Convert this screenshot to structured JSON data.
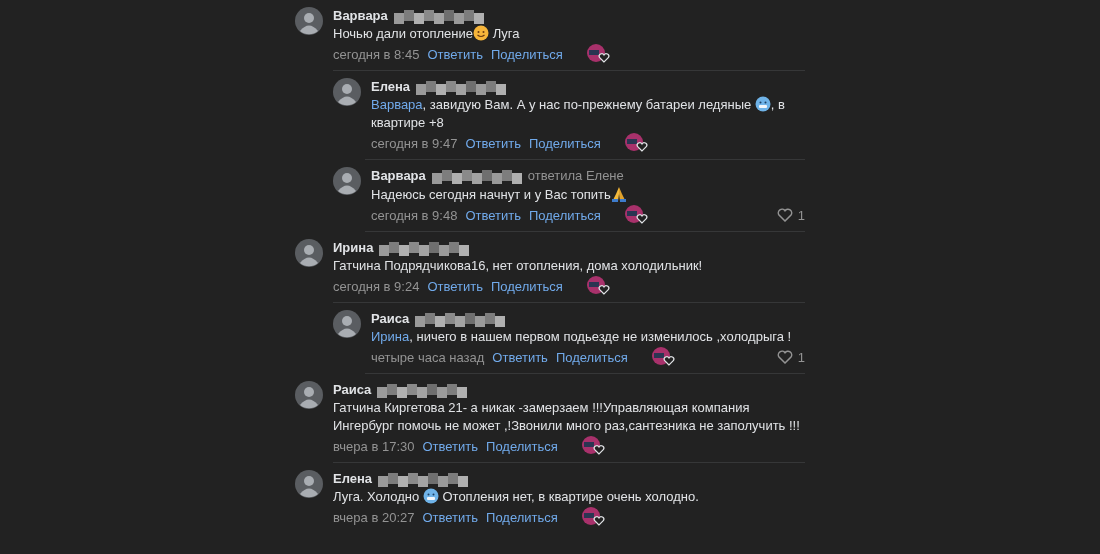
{
  "comments": [
    {
      "author": "Варвара",
      "text": [
        {
          "kind": "text",
          "text": "Ночью дали отопление"
        },
        {
          "kind": "smile"
        },
        {
          "kind": "text",
          "text": " Луга"
        }
      ],
      "time": "сегодня в 8:45",
      "reply": "Ответить",
      "share": "Поделиться",
      "replies": [
        {
          "author": "Елена",
          "text": [
            {
              "kind": "mention",
              "text": "Варвара"
            },
            {
              "kind": "text",
              "text": ", завидую Вам. А у нас по-прежнему батареи ледяные "
            },
            {
              "kind": "cold"
            },
            {
              "kind": "text",
              "text": ", в квартире +8"
            }
          ],
          "time": "сегодня в 9:47",
          "reply": "Ответить",
          "share": "Поделиться"
        },
        {
          "author": "Варвара",
          "answered": "ответила Елене",
          "text": [
            {
              "kind": "text",
              "text": "Надеюсь сегодня начнут и у Вас топить"
            },
            {
              "kind": "pray"
            }
          ],
          "time": "сегодня в 9:48",
          "reply": "Ответить",
          "share": "Поделиться",
          "likes": "1"
        }
      ]
    },
    {
      "author": "Ирина",
      "text": [
        {
          "kind": "text",
          "text": "Гатчина Подрядчикова16, нет отопления, дома холодильник!"
        }
      ],
      "time": "сегодня в 9:24",
      "reply": "Ответить",
      "share": "Поделиться",
      "replies": [
        {
          "author": "Раиса",
          "text": [
            {
              "kind": "mention",
              "text": "Ирина"
            },
            {
              "kind": "text",
              "text": ", ничего в нашем первом подьезде не изменилось ,холодрыга !"
            }
          ],
          "time": "четыре часа назад",
          "reply": "Ответить",
          "share": "Поделиться",
          "likes": "1"
        }
      ]
    },
    {
      "author": "Раиса",
      "text": [
        {
          "kind": "text",
          "text": "Гатчина Киргетова 21- а никак -замерзаем !!!Управляющая компания Ингербург помочь не может ,!Звонили много раз,сантезника не заполучить !!!"
        }
      ],
      "time": "вчера в 17:30",
      "reply": "Ответить",
      "share": "Поделиться"
    },
    {
      "author": "Елена",
      "text": [
        {
          "kind": "text",
          "text": "Луга. Холодно "
        },
        {
          "kind": "cold"
        },
        {
          "kind": "text",
          "text": " Отопления нет, в квартире очень холодно."
        }
      ],
      "time": "вчера в 20:27",
      "reply": "Ответить",
      "share": "Поделиться"
    }
  ]
}
